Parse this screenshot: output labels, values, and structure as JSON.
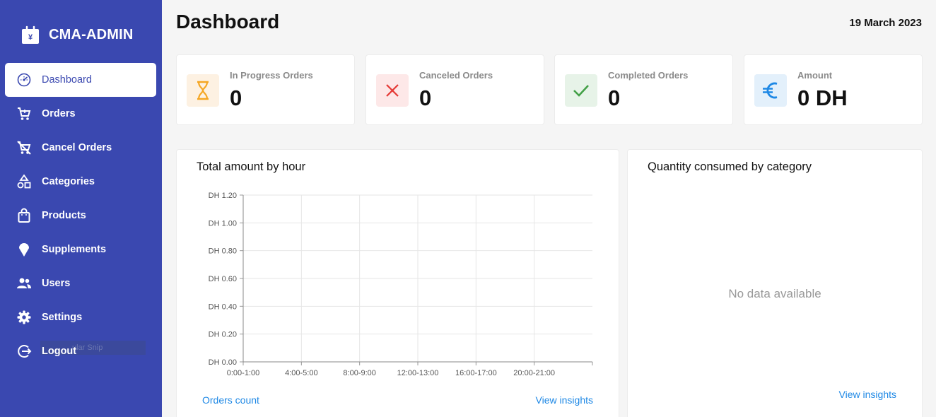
{
  "app": {
    "title": "CMA-ADMIN",
    "logo_icon": "shopping-bag-yen-icon"
  },
  "sidebar": {
    "items": [
      {
        "label": "Dashboard",
        "icon": "speedometer-icon",
        "active": true
      },
      {
        "label": "Orders",
        "icon": "cart-icon",
        "active": false
      },
      {
        "label": "Cancel Orders",
        "icon": "cart-off-icon",
        "active": false
      },
      {
        "label": "Categories",
        "icon": "shapes-icon",
        "active": false
      },
      {
        "label": "Products",
        "icon": "bag-icon",
        "active": false
      },
      {
        "label": "Supplements",
        "icon": "ice-cream-icon",
        "active": false
      },
      {
        "label": "Users",
        "icon": "users-icon",
        "active": false
      },
      {
        "label": "Settings",
        "icon": "gear-icon",
        "active": false
      },
      {
        "label": "Logout",
        "icon": "logout-icon",
        "active": false
      }
    ],
    "overlay_text": "ular Snip"
  },
  "header": {
    "title": "Dashboard",
    "date": "19 March 2023"
  },
  "stats": [
    {
      "label": "In Progress Orders",
      "value": "0",
      "icon": "hourglass-icon",
      "color": "#f5a623",
      "bg": "#fdf1e2"
    },
    {
      "label": "Canceled Orders",
      "value": "0",
      "icon": "close-icon",
      "color": "#e53935",
      "bg": "#fde8e8"
    },
    {
      "label": "Completed Orders",
      "value": "0",
      "icon": "check-icon",
      "color": "#43a047",
      "bg": "#e7f3e8"
    },
    {
      "label": "Amount",
      "value": "0 DH",
      "icon": "euro-icon",
      "color": "#1e88e5",
      "bg": "#e3f0fb"
    }
  ],
  "panels": {
    "amount_by_hour": {
      "title": "Total amount by hour",
      "link_left": "Orders count",
      "link_right": "View insights"
    },
    "quantity_by_category": {
      "title": "Quantity consumed by category",
      "empty_text": "No data available",
      "link": "View insights"
    }
  },
  "chart_data": {
    "type": "line",
    "title": "Total amount by hour",
    "xlabel": "",
    "ylabel": "",
    "categories": [
      "0:00-1:00",
      "4:00-5:00",
      "8:00-9:00",
      "12:00-13:00",
      "16:00-17:00",
      "20:00-21:00"
    ],
    "y_ticks": [
      "DH 0.00",
      "DH 0.20",
      "DH 0.40",
      "DH 0.60",
      "DH 0.80",
      "DH 1.00",
      "DH 1.20"
    ],
    "ylim": [
      0,
      1.2
    ],
    "grid": true,
    "series": []
  }
}
